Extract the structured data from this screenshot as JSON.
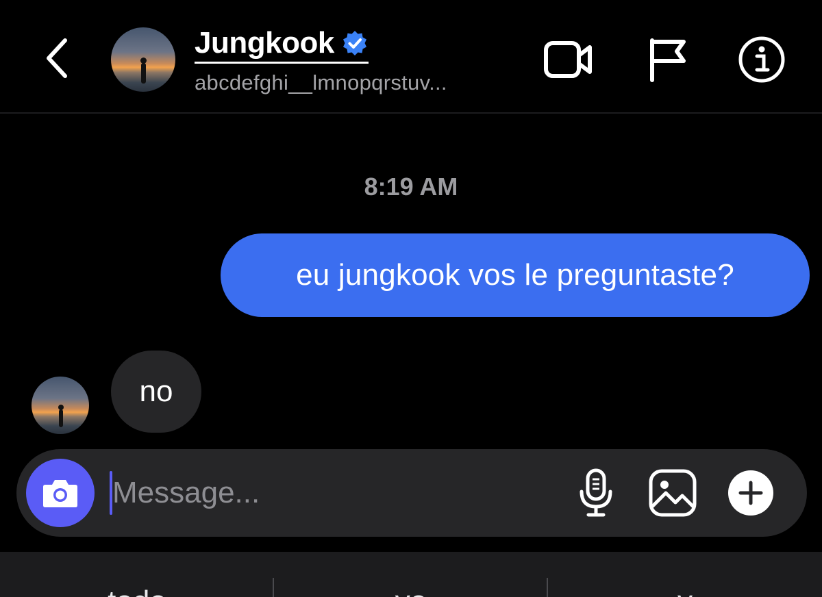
{
  "header": {
    "contact_name": "Jungkook",
    "username": "abcdefghi__lmnopqrstuv...",
    "verified": true
  },
  "chat": {
    "timestamp": "8:19 AM",
    "messages": [
      {
        "direction": "outgoing",
        "text": "eu jungkook vos le preguntaste?"
      },
      {
        "direction": "incoming",
        "text": "no"
      }
    ]
  },
  "composer": {
    "placeholder": "Message...",
    "value": ""
  },
  "keyboard_suggestions": [
    "todo",
    "yo",
    "y"
  ],
  "icons": {
    "back": "chevron-left-icon",
    "video": "video-camera-icon",
    "flag": "flag-icon",
    "info": "info-icon",
    "camera": "camera-icon",
    "mic": "microphone-icon",
    "gallery": "image-icon",
    "plus": "plus-icon",
    "verified": "verified-badge-icon"
  },
  "colors": {
    "background": "#000000",
    "outgoing_bubble": "#3b6ef0",
    "incoming_bubble": "#262628",
    "composer": "#262628",
    "camera_button": "#5a5cf6",
    "verified": "#3b82f6",
    "secondary_text": "#a4a4a8"
  }
}
